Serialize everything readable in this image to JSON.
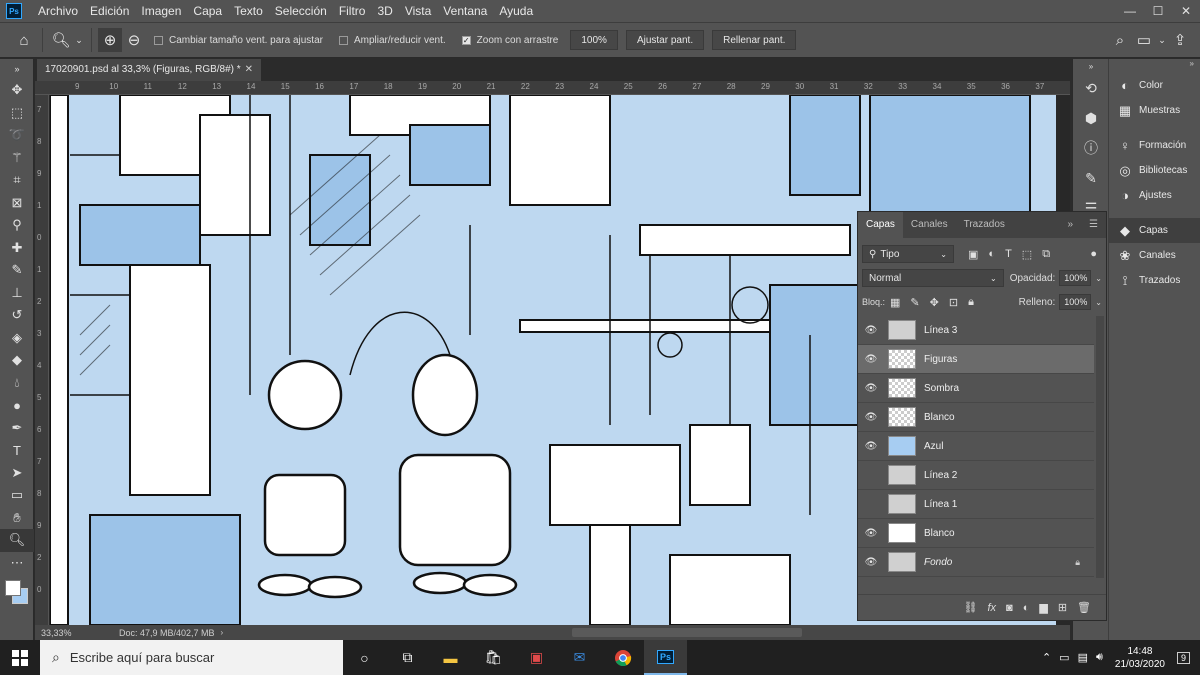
{
  "app": {
    "logo": "Ps"
  },
  "menu": [
    "Archivo",
    "Edición",
    "Imagen",
    "Capa",
    "Texto",
    "Selección",
    "Filtro",
    "3D",
    "Vista",
    "Ventana",
    "Ayuda"
  ],
  "window_controls": {
    "minimize": "—",
    "maximize": "☐",
    "close": "✕"
  },
  "options": {
    "resize_window": "Cambiar tamaño vent. para ajustar",
    "zoom_all": "Ampliar/reducir vent.",
    "scrubby_zoom": "Zoom con arrastre",
    "zoom_value": "100%",
    "fit_screen": "Ajustar pant.",
    "fill_screen": "Rellenar pant."
  },
  "document": {
    "tab_title": "17020901.psd al 33,3% (Figuras, RGB/8#) *",
    "zoom": "33,33%",
    "doc_info": "Doc: 47,9 MB/402,7 MB"
  },
  "ruler": {
    "top": [
      "9",
      "10",
      "11",
      "12",
      "13",
      "14",
      "15",
      "16",
      "17",
      "18",
      "19",
      "20",
      "21",
      "22",
      "23",
      "24",
      "25",
      "26",
      "27",
      "28",
      "29",
      "30",
      "31",
      "32",
      "33",
      "34",
      "35",
      "36",
      "37"
    ],
    "left": [
      "7",
      "8",
      "9",
      "1",
      "0",
      "1",
      "2",
      "3",
      "4",
      "5",
      "6",
      "7",
      "8",
      "9",
      "2",
      "0"
    ]
  },
  "right_panel": [
    {
      "icon": "color-icon",
      "glyph": "◐",
      "label": "Color"
    },
    {
      "icon": "swatches-icon",
      "glyph": "▦",
      "label": "Muestras"
    },
    {
      "icon": "learn-icon",
      "glyph": "♀",
      "label": "Formación"
    },
    {
      "icon": "libraries-icon",
      "glyph": "◎",
      "label": "Bibliotecas"
    },
    {
      "icon": "adjustments-icon",
      "glyph": "◑",
      "label": "Ajustes"
    },
    {
      "icon": "layers-icon",
      "glyph": "◆",
      "label": "Capas"
    },
    {
      "icon": "channels-icon",
      "glyph": "❀",
      "label": "Canales"
    },
    {
      "icon": "paths-icon",
      "glyph": "⟟",
      "label": "Trazados"
    }
  ],
  "layers_panel": {
    "tabs": [
      "Capas",
      "Canales",
      "Trazados"
    ],
    "filter": "Tipo",
    "blend_mode": "Normal",
    "opacity_label": "Opacidad:",
    "opacity": "100%",
    "lock_label": "Bloq.:",
    "fill_label": "Relleno:",
    "fill": "100%",
    "layers": [
      {
        "name": "Línea 3",
        "visible": true,
        "thumb": "ink",
        "selected": false
      },
      {
        "name": "Figuras",
        "visible": true,
        "thumb": "checker",
        "selected": true
      },
      {
        "name": "Sombra",
        "visible": true,
        "thumb": "checker",
        "selected": false
      },
      {
        "name": "Blanco",
        "visible": true,
        "thumb": "checker",
        "selected": false
      },
      {
        "name": "Azul",
        "visible": true,
        "thumb": "blue",
        "selected": false
      },
      {
        "name": "Línea 2",
        "visible": false,
        "thumb": "ink",
        "selected": false
      },
      {
        "name": "Línea 1",
        "visible": false,
        "thumb": "ink",
        "selected": false
      },
      {
        "name": "Blanco",
        "visible": true,
        "thumb": "white",
        "selected": false
      },
      {
        "name": "Fondo",
        "visible": true,
        "thumb": "ink",
        "selected": false,
        "locked": true,
        "italic": true
      }
    ]
  },
  "taskbar": {
    "search_placeholder": "Escribe aquí para buscar",
    "time": "14:48",
    "date": "21/03/2020",
    "notifications": "9"
  },
  "colors": {
    "canvas_blue": "#bed8f0",
    "ui_gray": "#535353",
    "ps_blue": "#31a8ff"
  }
}
